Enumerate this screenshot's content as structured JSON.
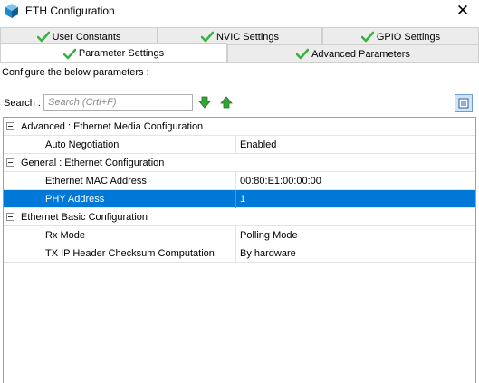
{
  "window": {
    "title": "ETH Configuration"
  },
  "tabs": [
    {
      "label": "User Constants"
    },
    {
      "label": "NVIC Settings"
    },
    {
      "label": "GPIO Settings"
    },
    {
      "label": "Parameter Settings"
    },
    {
      "label": "Advanced Parameters"
    }
  ],
  "active_tab": "Parameter Settings",
  "hint": "Configure the below parameters :",
  "search": {
    "label": "Search :",
    "placeholder": "Search (Crtl+F)"
  },
  "groups": [
    {
      "label": "Advanced : Ethernet Media Configuration",
      "params": [
        {
          "name": "Auto Negotiation",
          "value": "Enabled"
        }
      ]
    },
    {
      "label": "General : Ethernet Configuration",
      "params": [
        {
          "name": "Ethernet MAC Address",
          "value": "00:80:E1:00:00:00"
        },
        {
          "name": "PHY Address",
          "value": "1",
          "selected": true
        }
      ]
    },
    {
      "label": "Ethernet Basic Configuration",
      "params": [
        {
          "name": "Rx Mode",
          "value": "Polling Mode"
        },
        {
          "name": "TX IP Header Checksum Computation",
          "value": "By hardware"
        }
      ]
    }
  ],
  "colors": {
    "selection": "#0078d7",
    "check": "#3cb043",
    "arrow": "#32a532"
  }
}
